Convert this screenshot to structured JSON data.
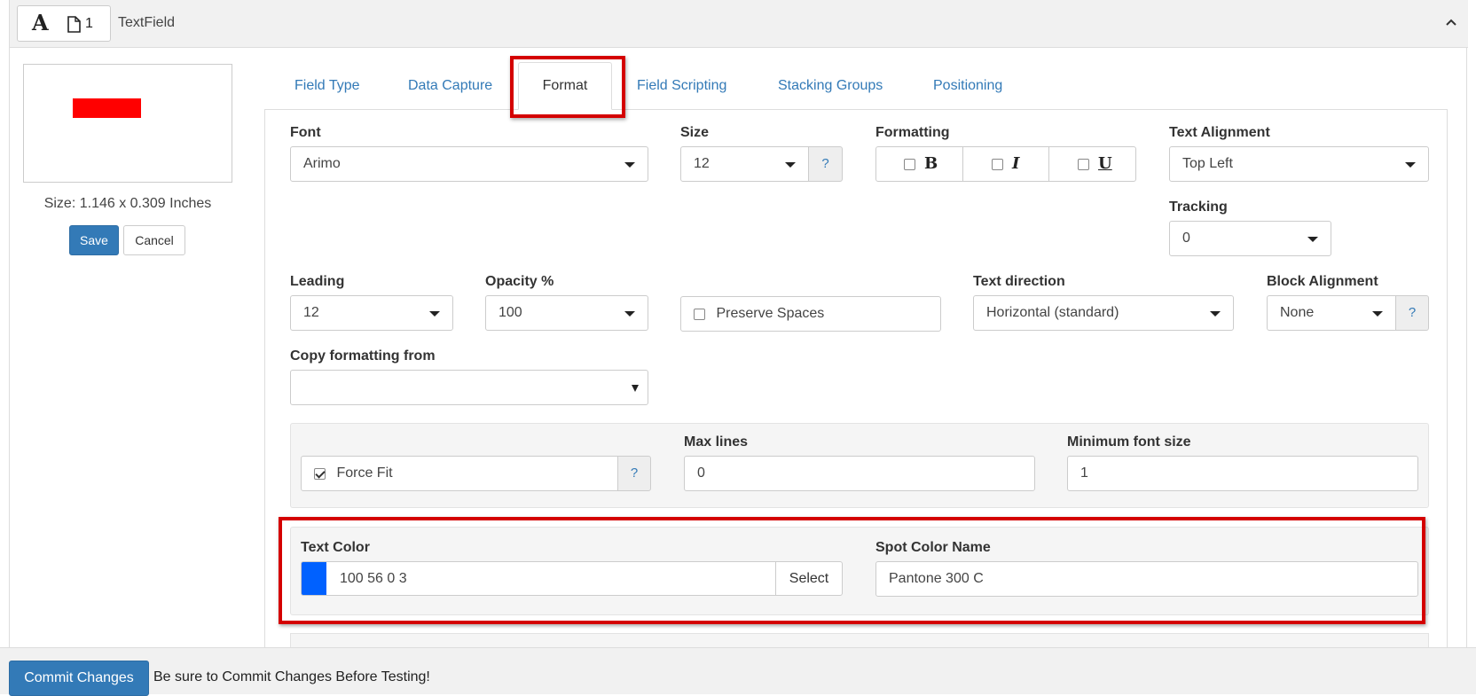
{
  "header": {
    "page_count": "1",
    "title": "TextField"
  },
  "preview": {
    "mark_color": "#ff0000",
    "size_text": "Size: 1.146 x 0.309 Inches",
    "save_label": "Save",
    "cancel_label": "Cancel"
  },
  "tabs": [
    {
      "label": "Field Type"
    },
    {
      "label": "Data Capture"
    },
    {
      "label": "Format"
    },
    {
      "label": "Field Scripting"
    },
    {
      "label": "Stacking Groups"
    },
    {
      "label": "Positioning"
    }
  ],
  "active_tab": "Format",
  "format": {
    "font": {
      "label": "Font",
      "value": "Arimo"
    },
    "size": {
      "label": "Size",
      "value": "12",
      "help": "?"
    },
    "formatting": {
      "label": "Formatting",
      "bold": "B",
      "italic": "I",
      "underline": "U"
    },
    "text_alignment": {
      "label": "Text Alignment",
      "value": "Top Left"
    },
    "tracking": {
      "label": "Tracking",
      "value": "0"
    },
    "leading": {
      "label": "Leading",
      "value": "12"
    },
    "opacity": {
      "label": "Opacity %",
      "value": "100"
    },
    "preserve_spaces": {
      "label": "Preserve Spaces"
    },
    "text_direction": {
      "label": "Text direction",
      "value": "Horizontal (standard)"
    },
    "block_alignment": {
      "label": "Block Alignment",
      "value": "None",
      "help": "?"
    },
    "copy_formatting": {
      "label": "Copy formatting from",
      "value": ""
    },
    "force_fit": {
      "label": "Force Fit",
      "checked": true,
      "help": "?"
    },
    "max_lines": {
      "label": "Max lines",
      "value": "0"
    },
    "min_font_size": {
      "label": "Minimum font size",
      "value": "1"
    },
    "text_color": {
      "label": "Text Color",
      "swatch": "#0061ff",
      "value": "100 56 0 3",
      "select_label": "Select"
    },
    "spot_color": {
      "label": "Spot Color Name",
      "value": "Pantone 300 C"
    }
  },
  "footer": {
    "commit_label": "Commit Changes",
    "note": "Be sure to Commit Changes Before Testing!"
  }
}
